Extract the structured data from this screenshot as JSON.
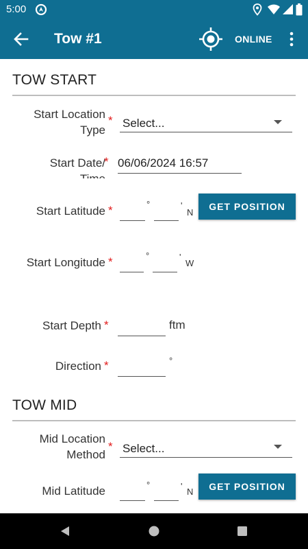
{
  "status_bar": {
    "time": "5:00"
  },
  "app_bar": {
    "title": "Tow #1",
    "online_label": "ONLINE"
  },
  "colors": {
    "primary": "#0f6e92",
    "required": "#e21b1b"
  },
  "tow_start": {
    "section_title": "TOW START",
    "location_type": {
      "label_line1": "Start Location",
      "label_line2": "Type",
      "value": "Select..."
    },
    "date_time": {
      "label_line1": "Start Date/",
      "label_line2": "Time",
      "value": "06/06/2024 16:57"
    },
    "latitude": {
      "label": "Start Latitude",
      "deg": "°",
      "min": "'",
      "hemisphere": "N",
      "button": "GET POSITION"
    },
    "longitude": {
      "label": "Start Longitude",
      "deg": "°",
      "min": "'",
      "hemisphere": "W"
    },
    "depth": {
      "label": "Start Depth",
      "unit": "ftm"
    },
    "direction": {
      "label": "Direction",
      "unit": "°"
    }
  },
  "tow_mid": {
    "section_title": "TOW MID",
    "location_method": {
      "label_line1": "Mid Location",
      "label_line2": "Method",
      "value": "Select..."
    },
    "latitude": {
      "label": "Mid Latitude",
      "deg": "°",
      "min": "'",
      "hemisphere": "N",
      "button": "GET POSITION"
    }
  },
  "required_marker": "*",
  "icons": [
    "navigation-icon",
    "location-pin-icon",
    "wifi-icon",
    "signal-icon",
    "battery-icon",
    "back-arrow-icon",
    "gps-target-icon",
    "more-vert-icon",
    "nav-back-icon",
    "nav-home-icon",
    "nav-recents-icon"
  ]
}
